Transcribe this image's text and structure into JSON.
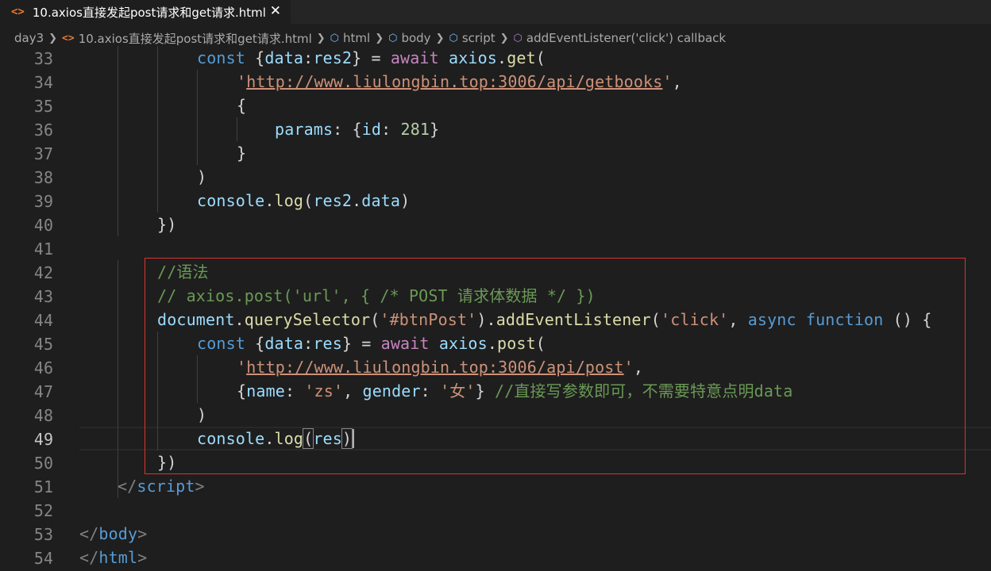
{
  "tab": {
    "icon": "<>",
    "title": "10.axios直接发起post请求和get请求.html",
    "close": "✕"
  },
  "breadcrumb": {
    "folder": "day3",
    "file": "10.axios直接发起post请求和get请求.html",
    "html": "html",
    "body": "body",
    "script": "script",
    "callback": "addEventListener('click') callback"
  },
  "lines": [
    {
      "n": "33",
      "t": [
        [
          "kw",
          "const"
        ],
        [
          "p",
          " {"
        ],
        [
          "v",
          "data"
        ],
        [
          "p",
          ":"
        ],
        [
          "v",
          "res2"
        ],
        [
          "p",
          "} = "
        ],
        [
          "kc",
          "await"
        ],
        [
          "p",
          " "
        ],
        [
          "v",
          "axios"
        ],
        [
          "p",
          "."
        ],
        [
          "fn",
          "get"
        ],
        [
          "p",
          "("
        ]
      ]
    },
    {
      "n": "34",
      "t": [
        [
          "s",
          "'"
        ],
        [
          "u",
          "http://www.liulongbin.top:3006/api/getbooks"
        ],
        [
          "s",
          "'"
        ],
        [
          "p",
          ","
        ]
      ]
    },
    {
      "n": "35",
      "t": [
        [
          "p",
          "{"
        ]
      ]
    },
    {
      "n": "36",
      "t": [
        [
          "v",
          "params"
        ],
        [
          "p",
          ": {"
        ],
        [
          "v",
          "id"
        ],
        [
          "p",
          ": "
        ],
        [
          "n",
          "281"
        ],
        [
          "p",
          "}"
        ]
      ]
    },
    {
      "n": "37",
      "t": [
        [
          "p",
          "}"
        ]
      ]
    },
    {
      "n": "38",
      "t": [
        [
          "p",
          ")"
        ]
      ]
    },
    {
      "n": "39",
      "t": [
        [
          "v",
          "console"
        ],
        [
          "p",
          "."
        ],
        [
          "fn",
          "log"
        ],
        [
          "p",
          "("
        ],
        [
          "v",
          "res2"
        ],
        [
          "p",
          "."
        ],
        [
          "v",
          "data"
        ],
        [
          "p",
          ")"
        ]
      ]
    },
    {
      "n": "40",
      "t": [
        [
          "p",
          "})"
        ]
      ]
    },
    {
      "n": "41",
      "t": []
    },
    {
      "n": "42",
      "t": [
        [
          "c",
          "//语法"
        ]
      ]
    },
    {
      "n": "43",
      "t": [
        [
          "c",
          "// axios.post('url', { /* POST 请求体数据 */ })"
        ]
      ]
    },
    {
      "n": "44",
      "t": [
        [
          "v",
          "document"
        ],
        [
          "p",
          "."
        ],
        [
          "fn",
          "querySelector"
        ],
        [
          "p",
          "("
        ],
        [
          "s",
          "'#btnPost'"
        ],
        [
          "p",
          ")."
        ],
        [
          "fn",
          "addEventListener"
        ],
        [
          "p",
          "("
        ],
        [
          "s",
          "'click'"
        ],
        [
          "p",
          ", "
        ],
        [
          "kw",
          "async"
        ],
        [
          "p",
          " "
        ],
        [
          "kw",
          "function"
        ],
        [
          "p",
          " () {"
        ]
      ]
    },
    {
      "n": "45",
      "t": [
        [
          "kw",
          "const"
        ],
        [
          "p",
          " {"
        ],
        [
          "v",
          "data"
        ],
        [
          "p",
          ":"
        ],
        [
          "v",
          "res"
        ],
        [
          "p",
          "} = "
        ],
        [
          "kc",
          "await"
        ],
        [
          "p",
          " "
        ],
        [
          "v",
          "axios"
        ],
        [
          "p",
          "."
        ],
        [
          "fn",
          "post"
        ],
        [
          "p",
          "("
        ]
      ]
    },
    {
      "n": "46",
      "t": [
        [
          "s",
          "'"
        ],
        [
          "u",
          "http://www.liulongbin.top:3006/api/post"
        ],
        [
          "s",
          "'"
        ],
        [
          "p",
          ","
        ]
      ]
    },
    {
      "n": "47",
      "t": [
        [
          "p",
          "{"
        ],
        [
          "v",
          "name"
        ],
        [
          "p",
          ": "
        ],
        [
          "s",
          "'zs'"
        ],
        [
          "p",
          ", "
        ],
        [
          "v",
          "gender"
        ],
        [
          "p",
          ": "
        ],
        [
          "s",
          "'女'"
        ],
        [
          "p",
          "} "
        ],
        [
          "c",
          "//直接写参数即可，不需要特意点明data"
        ]
      ]
    },
    {
      "n": "48",
      "t": [
        [
          "p",
          ")"
        ]
      ]
    },
    {
      "n": "49",
      "t": [
        [
          "v",
          "console"
        ],
        [
          "p",
          "."
        ],
        [
          "fn",
          "log"
        ],
        [
          "bm",
          "("
        ],
        [
          "v",
          "res"
        ],
        [
          "bm",
          ")"
        ]
      ]
    },
    {
      "n": "50",
      "t": [
        [
          "p",
          "})"
        ]
      ]
    },
    {
      "n": "51",
      "t": [
        [
          "br",
          "</"
        ],
        [
          "tag",
          "script"
        ],
        [
          "br",
          ">"
        ]
      ]
    },
    {
      "n": "52",
      "t": []
    },
    {
      "n": "53",
      "t": [
        [
          "br",
          "</"
        ],
        [
          "tag",
          "body"
        ],
        [
          "br",
          ">"
        ]
      ]
    },
    {
      "n": "54",
      "t": [
        [
          "br",
          "</"
        ],
        [
          "tag",
          "html"
        ],
        [
          "br",
          ">"
        ]
      ]
    }
  ],
  "active_line": "49"
}
